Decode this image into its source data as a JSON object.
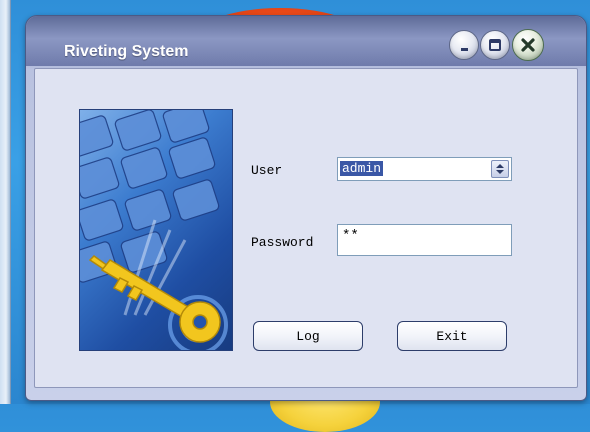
{
  "window": {
    "title": "Riveting System",
    "controls": [
      "minimize-icon",
      "maximize-icon",
      "close-icon"
    ]
  },
  "form": {
    "user_label": "User",
    "user_value": "admin",
    "password_label": "Password",
    "password_value": "**",
    "log_button": "Log",
    "exit_button": "Exit"
  },
  "image": {
    "subject": "keyboard-and-key"
  }
}
